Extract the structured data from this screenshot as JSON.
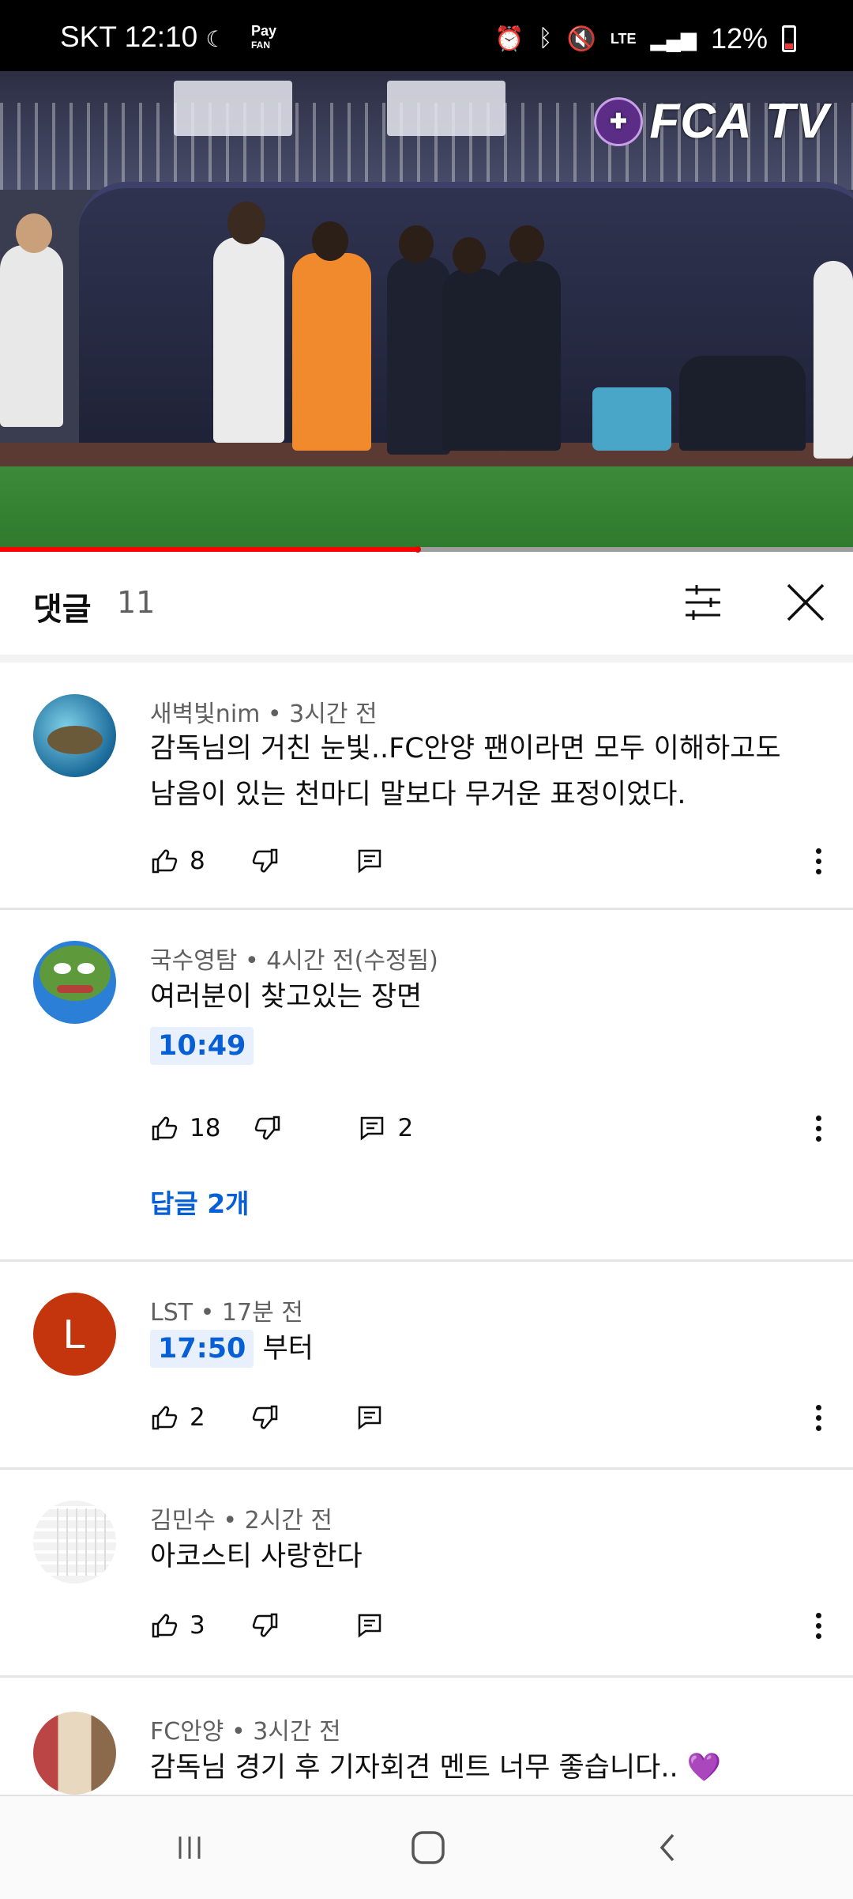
{
  "status_bar": {
    "carrier": "SKT",
    "time": "12:10",
    "pay_label_top": "Pay",
    "pay_label_bottom": "FAN",
    "network": "LTE",
    "battery": "12%"
  },
  "video": {
    "channel_logo": "FCA TV",
    "progress": 0.49,
    "colors": {
      "accent": "#ff0000"
    }
  },
  "comments_header": {
    "title": "댓글",
    "count": "11",
    "sort_icon": "sort-filter-icon",
    "close_icon": "close-icon"
  },
  "comments": [
    {
      "author": "새벽빛nim",
      "time": "3시간 전",
      "text_lines": [
        "감독님의 거친 눈빛..FC안양 팬이라면 모두 이해하고도",
        "남음이 있는 천마디 말보다 무거운 표정이었다."
      ],
      "likes": "8",
      "replies_count": ""
    },
    {
      "author": "국수영탐",
      "time": "4시간 전(수정됨)",
      "text": "여러분이 찾고있는 장면",
      "timestamp": "10:49",
      "likes": "18",
      "replies_count": "2",
      "replies_link": "답글 2개"
    },
    {
      "author": "LST",
      "time": "17분 전",
      "timestamp": "17:50",
      "text_after": "부터",
      "likes": "2",
      "avatar_letter": "L"
    },
    {
      "author": "김민수",
      "time": "2시간 전",
      "text": "아코스티 사랑한다",
      "likes": "3"
    },
    {
      "author": "FC안양",
      "time": "3시간 전",
      "text": "감독님 경기 후 기자회견 멘트 너무 좋습니다.. 💜"
    }
  ],
  "meta_separator": "•",
  "nav_bar": {
    "recents_icon": "recents-icon",
    "home_icon": "home-icon",
    "back_icon": "back-icon"
  }
}
